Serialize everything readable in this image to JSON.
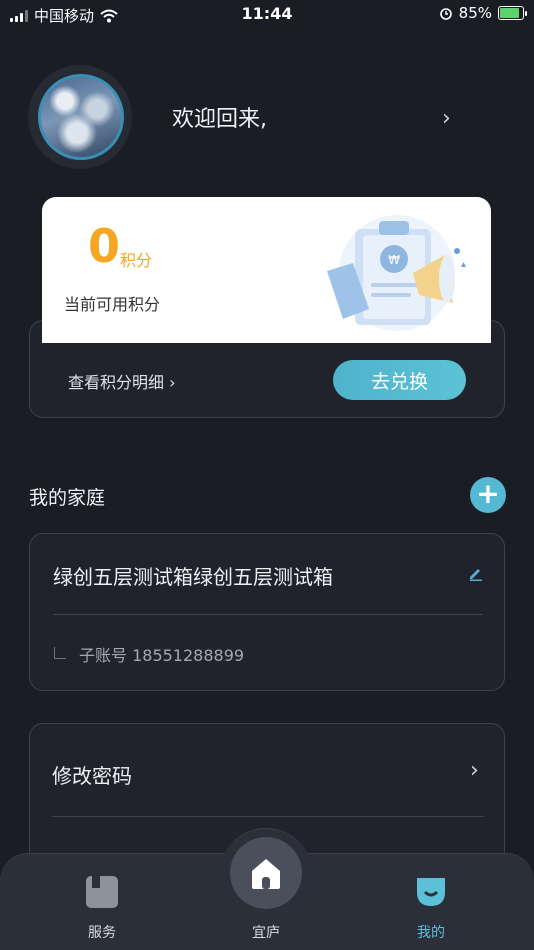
{
  "status_bar": {
    "carrier": "中国移动",
    "time": "11:44",
    "battery": "85%"
  },
  "profile": {
    "welcome": "欢迎回来,"
  },
  "points": {
    "value": "0",
    "unit": "积分",
    "label": "当前可用积分",
    "detail_link": "查看积分明细",
    "exchange_button": "去兑换"
  },
  "family": {
    "title": "我的家庭",
    "name": "绿创五层测试箱绿创五层测试箱",
    "sub_account": "子账号 18551288899"
  },
  "settings": {
    "change_password": "修改密码"
  },
  "tabbar": {
    "tabs": [
      {
        "label": "服务"
      },
      {
        "label": "宜庐"
      },
      {
        "label": "我的"
      }
    ]
  }
}
